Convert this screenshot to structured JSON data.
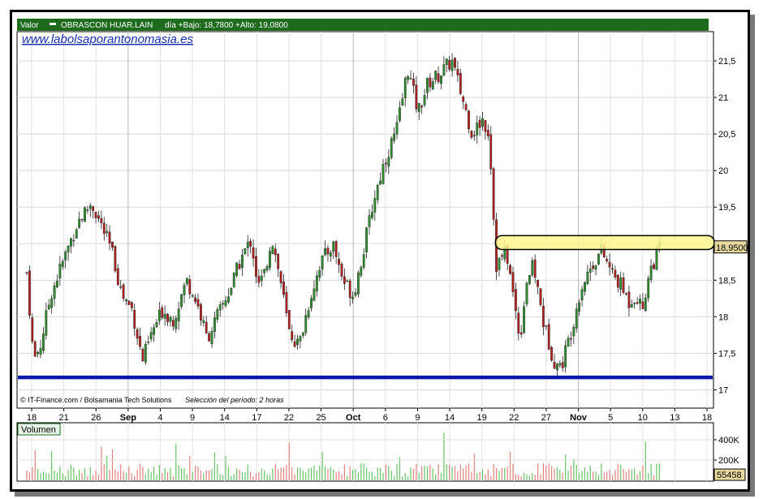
{
  "header": {
    "field_label": "Valor",
    "ticker": "OBRASCON HUAR.LAIN",
    "stats": "día +Bajo: 18,7800 +Alto: 19,0800"
  },
  "watermark_url": "www.labolsaporantonomasia.es",
  "credits": {
    "source": "© IT-Finance.com / Bolsamania Tech Solutions",
    "period": "Selección del período: 2 horas"
  },
  "volume_panel": {
    "label": "Volumen",
    "ticks": [
      {
        "label": "400K",
        "value": 400000
      },
      {
        "label": "200K",
        "value": 200000
      }
    ],
    "last_value_label": "55458",
    "last_value": 55458,
    "ymax": 560000
  },
  "last_price_label": "18,9500",
  "colors": {
    "up": "#2e8b2e",
    "down": "#b02020",
    "support_line": "#0a1aa8",
    "resistance_band": "#fff68c",
    "header_bg": "#1e6b1e",
    "label_box_bg": "#e8d9a0",
    "volume_up": "#66c266",
    "volume_down": "#e08080"
  },
  "chart_data": {
    "type": "candlestick",
    "ylim": [
      16.75,
      21.9
    ],
    "y_ticks": [
      {
        "label": "21,5",
        "value": 21.5
      },
      {
        "label": "21",
        "value": 21
      },
      {
        "label": "20,5",
        "value": 20.5
      },
      {
        "label": "20",
        "value": 20
      },
      {
        "label": "19,5",
        "value": 19.5
      },
      {
        "label": "19",
        "value": 19
      },
      {
        "label": "18,5",
        "value": 18.5
      },
      {
        "label": "18",
        "value": 18
      },
      {
        "label": "17,5",
        "value": 17.5
      },
      {
        "label": "17",
        "value": 17
      }
    ],
    "x_ticks": [
      {
        "label": "18",
        "major": false
      },
      {
        "label": "21",
        "major": false
      },
      {
        "label": "26",
        "major": false
      },
      {
        "label": "Sep",
        "major": true
      },
      {
        "label": "4",
        "major": false
      },
      {
        "label": "9",
        "major": false
      },
      {
        "label": "14",
        "major": false
      },
      {
        "label": "17",
        "major": false
      },
      {
        "label": "22",
        "major": false
      },
      {
        "label": "25",
        "major": false
      },
      {
        "label": "Oct",
        "major": true
      },
      {
        "label": "6",
        "major": false
      },
      {
        "label": "9",
        "major": false
      },
      {
        "label": "14",
        "major": false
      },
      {
        "label": "19",
        "major": false
      },
      {
        "label": "22",
        "major": false
      },
      {
        "label": "27",
        "major": false
      },
      {
        "label": "Nov",
        "major": true
      },
      {
        "label": "5",
        "major": false
      },
      {
        "label": "10",
        "major": false
      },
      {
        "label": "13",
        "major": false
      },
      {
        "label": "18",
        "major": false
      }
    ],
    "support_level": 17.17,
    "resistance_band": [
      18.92,
      19.11
    ],
    "last_price": 18.95,
    "close_path": [
      [
        0.0,
        18.6
      ],
      [
        0.01,
        17.4
      ],
      [
        0.02,
        17.6
      ],
      [
        0.035,
        18.3
      ],
      [
        0.055,
        18.8
      ],
      [
        0.075,
        19.3
      ],
      [
        0.095,
        19.55
      ],
      [
        0.105,
        19.35
      ],
      [
        0.125,
        18.9
      ],
      [
        0.14,
        18.3
      ],
      [
        0.155,
        18.1
      ],
      [
        0.17,
        17.4
      ],
      [
        0.185,
        17.8
      ],
      [
        0.2,
        18.1
      ],
      [
        0.215,
        17.95
      ],
      [
        0.235,
        18.5
      ],
      [
        0.25,
        18.2
      ],
      [
        0.265,
        17.7
      ],
      [
        0.28,
        18.0
      ],
      [
        0.3,
        18.4
      ],
      [
        0.315,
        18.8
      ],
      [
        0.33,
        19.05
      ],
      [
        0.34,
        18.4
      ],
      [
        0.35,
        18.6
      ],
      [
        0.36,
        19.1
      ],
      [
        0.375,
        18.4
      ],
      [
        0.385,
        17.8
      ],
      [
        0.4,
        17.6
      ],
      [
        0.415,
        18.2
      ],
      [
        0.43,
        18.7
      ],
      [
        0.45,
        19.0
      ],
      [
        0.465,
        18.5
      ],
      [
        0.48,
        18.3
      ],
      [
        0.495,
        18.9
      ],
      [
        0.51,
        19.6
      ],
      [
        0.525,
        20.1
      ],
      [
        0.545,
        20.6
      ],
      [
        0.56,
        21.4
      ],
      [
        0.575,
        20.8
      ],
      [
        0.59,
        21.2
      ],
      [
        0.605,
        21.3
      ],
      [
        0.625,
        21.5
      ],
      [
        0.64,
        21.0
      ],
      [
        0.655,
        20.5
      ],
      [
        0.67,
        20.7
      ],
      [
        0.68,
        20.5
      ],
      [
        0.69,
        18.7
      ],
      [
        0.705,
        18.9
      ],
      [
        0.715,
        18.3
      ],
      [
        0.725,
        17.7
      ],
      [
        0.735,
        18.5
      ],
      [
        0.745,
        18.7
      ],
      [
        0.76,
        17.9
      ],
      [
        0.775,
        17.4
      ],
      [
        0.785,
        17.3
      ],
      [
        0.8,
        17.8
      ],
      [
        0.815,
        18.4
      ],
      [
        0.83,
        18.7
      ],
      [
        0.845,
        18.9
      ],
      [
        0.86,
        18.6
      ],
      [
        0.875,
        18.4
      ],
      [
        0.885,
        18.2
      ],
      [
        0.895,
        18.3
      ],
      [
        0.905,
        18.1
      ],
      [
        0.915,
        18.6
      ],
      [
        0.93,
        18.95
      ]
    ]
  }
}
